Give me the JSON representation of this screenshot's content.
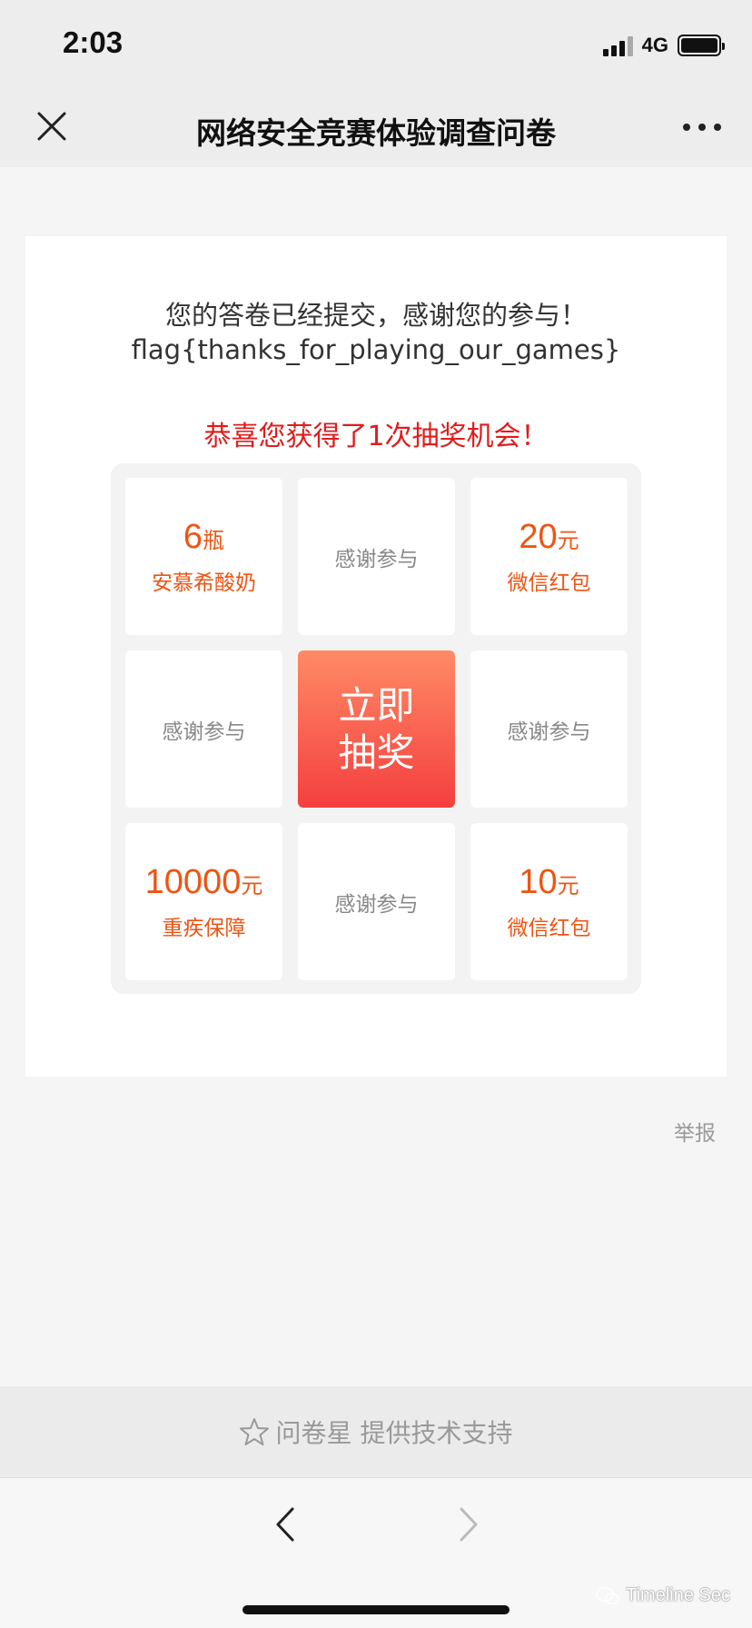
{
  "status_bar": {
    "time": "2:03",
    "network": "4G"
  },
  "nav": {
    "title": "网络安全竞赛体验调查问卷",
    "close_icon": "close-icon",
    "more_icon": "more-icon"
  },
  "card": {
    "message_line1": "您的答卷已经提交，感谢您的参与！",
    "message_line2": "flag{thanks_for_playing_our_games}",
    "congrats": "恭喜您获得了1次抽奖机会！"
  },
  "lottery": {
    "cells": [
      {
        "amount": "6",
        "unit": "瓶",
        "desc": "安慕希酸奶"
      },
      {
        "thanks": "感谢参与"
      },
      {
        "amount": "20",
        "unit": "元",
        "desc": "微信红包"
      },
      {
        "thanks": "感谢参与"
      },
      {
        "draw_line1": "立即",
        "draw_line2": "抽奖"
      },
      {
        "thanks": "感谢参与"
      },
      {
        "amount": "10000",
        "unit": "元",
        "desc": "重疾保障"
      },
      {
        "thanks": "感谢参与"
      },
      {
        "amount": "10",
        "unit": "元",
        "desc": "微信红包"
      }
    ],
    "prize_color": "#ee5413",
    "button_colors": [
      "#ff8a66",
      "#f43f3f"
    ]
  },
  "report_label": "举报",
  "footer": {
    "powered_by": "问卷星 提供技术支持",
    "star_icon": "star-icon"
  },
  "toolbar": {
    "back_icon": "back-arrow-icon",
    "forward_icon": "forward-arrow-icon"
  },
  "watermark": "Timeline Sec"
}
